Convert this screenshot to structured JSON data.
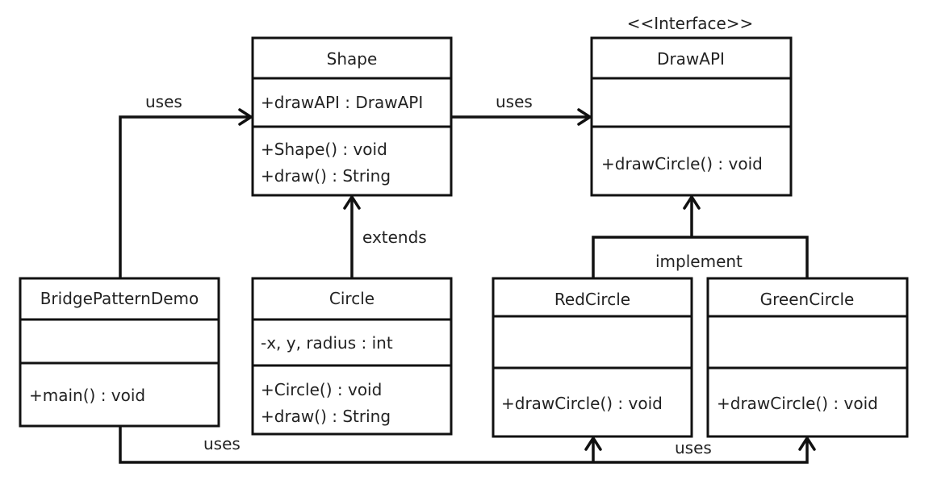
{
  "classes": {
    "shape": {
      "name": "Shape",
      "attributes": [
        "+drawAPI : DrawAPI"
      ],
      "methods": [
        "+Shape()  : void",
        "+draw() : String"
      ]
    },
    "drawapi": {
      "stereotype": "<<Interface>>",
      "name": "DrawAPI",
      "methods": [
        "+drawCircle()  : void"
      ]
    },
    "bridge": {
      "name": "BridgePatternDemo",
      "methods": [
        "+main()  : void"
      ]
    },
    "circle": {
      "name": "Circle",
      "attributes": [
        "-x, y,  radius  : int"
      ],
      "methods": [
        "+Circle()  : void",
        "+draw()  : String"
      ]
    },
    "red": {
      "name": "RedCircle",
      "methods": [
        "+drawCircle()  : void"
      ]
    },
    "green": {
      "name": "GreenCircle",
      "methods": [
        "+drawCircle()  : void"
      ]
    }
  },
  "relations": {
    "bridge_shape": "uses",
    "shape_drawapi": "uses",
    "extends": "extends",
    "implement": "implement",
    "bridge_red": "uses",
    "bridge_green": "uses"
  }
}
